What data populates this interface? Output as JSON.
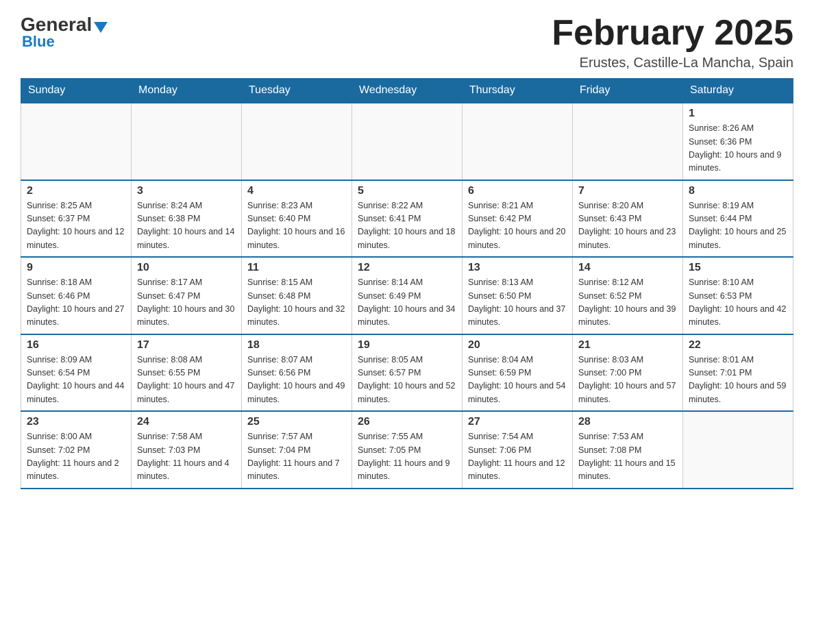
{
  "logo": {
    "general": "General",
    "blue": "Blue"
  },
  "header": {
    "title": "February 2025",
    "location": "Erustes, Castille-La Mancha, Spain"
  },
  "weekdays": [
    "Sunday",
    "Monday",
    "Tuesday",
    "Wednesday",
    "Thursday",
    "Friday",
    "Saturday"
  ],
  "weeks": [
    [
      {
        "day": "",
        "info": ""
      },
      {
        "day": "",
        "info": ""
      },
      {
        "day": "",
        "info": ""
      },
      {
        "day": "",
        "info": ""
      },
      {
        "day": "",
        "info": ""
      },
      {
        "day": "",
        "info": ""
      },
      {
        "day": "1",
        "info": "Sunrise: 8:26 AM\nSunset: 6:36 PM\nDaylight: 10 hours and 9 minutes."
      }
    ],
    [
      {
        "day": "2",
        "info": "Sunrise: 8:25 AM\nSunset: 6:37 PM\nDaylight: 10 hours and 12 minutes."
      },
      {
        "day": "3",
        "info": "Sunrise: 8:24 AM\nSunset: 6:38 PM\nDaylight: 10 hours and 14 minutes."
      },
      {
        "day": "4",
        "info": "Sunrise: 8:23 AM\nSunset: 6:40 PM\nDaylight: 10 hours and 16 minutes."
      },
      {
        "day": "5",
        "info": "Sunrise: 8:22 AM\nSunset: 6:41 PM\nDaylight: 10 hours and 18 minutes."
      },
      {
        "day": "6",
        "info": "Sunrise: 8:21 AM\nSunset: 6:42 PM\nDaylight: 10 hours and 20 minutes."
      },
      {
        "day": "7",
        "info": "Sunrise: 8:20 AM\nSunset: 6:43 PM\nDaylight: 10 hours and 23 minutes."
      },
      {
        "day": "8",
        "info": "Sunrise: 8:19 AM\nSunset: 6:44 PM\nDaylight: 10 hours and 25 minutes."
      }
    ],
    [
      {
        "day": "9",
        "info": "Sunrise: 8:18 AM\nSunset: 6:46 PM\nDaylight: 10 hours and 27 minutes."
      },
      {
        "day": "10",
        "info": "Sunrise: 8:17 AM\nSunset: 6:47 PM\nDaylight: 10 hours and 30 minutes."
      },
      {
        "day": "11",
        "info": "Sunrise: 8:15 AM\nSunset: 6:48 PM\nDaylight: 10 hours and 32 minutes."
      },
      {
        "day": "12",
        "info": "Sunrise: 8:14 AM\nSunset: 6:49 PM\nDaylight: 10 hours and 34 minutes."
      },
      {
        "day": "13",
        "info": "Sunrise: 8:13 AM\nSunset: 6:50 PM\nDaylight: 10 hours and 37 minutes."
      },
      {
        "day": "14",
        "info": "Sunrise: 8:12 AM\nSunset: 6:52 PM\nDaylight: 10 hours and 39 minutes."
      },
      {
        "day": "15",
        "info": "Sunrise: 8:10 AM\nSunset: 6:53 PM\nDaylight: 10 hours and 42 minutes."
      }
    ],
    [
      {
        "day": "16",
        "info": "Sunrise: 8:09 AM\nSunset: 6:54 PM\nDaylight: 10 hours and 44 minutes."
      },
      {
        "day": "17",
        "info": "Sunrise: 8:08 AM\nSunset: 6:55 PM\nDaylight: 10 hours and 47 minutes."
      },
      {
        "day": "18",
        "info": "Sunrise: 8:07 AM\nSunset: 6:56 PM\nDaylight: 10 hours and 49 minutes."
      },
      {
        "day": "19",
        "info": "Sunrise: 8:05 AM\nSunset: 6:57 PM\nDaylight: 10 hours and 52 minutes."
      },
      {
        "day": "20",
        "info": "Sunrise: 8:04 AM\nSunset: 6:59 PM\nDaylight: 10 hours and 54 minutes."
      },
      {
        "day": "21",
        "info": "Sunrise: 8:03 AM\nSunset: 7:00 PM\nDaylight: 10 hours and 57 minutes."
      },
      {
        "day": "22",
        "info": "Sunrise: 8:01 AM\nSunset: 7:01 PM\nDaylight: 10 hours and 59 minutes."
      }
    ],
    [
      {
        "day": "23",
        "info": "Sunrise: 8:00 AM\nSunset: 7:02 PM\nDaylight: 11 hours and 2 minutes."
      },
      {
        "day": "24",
        "info": "Sunrise: 7:58 AM\nSunset: 7:03 PM\nDaylight: 11 hours and 4 minutes."
      },
      {
        "day": "25",
        "info": "Sunrise: 7:57 AM\nSunset: 7:04 PM\nDaylight: 11 hours and 7 minutes."
      },
      {
        "day": "26",
        "info": "Sunrise: 7:55 AM\nSunset: 7:05 PM\nDaylight: 11 hours and 9 minutes."
      },
      {
        "day": "27",
        "info": "Sunrise: 7:54 AM\nSunset: 7:06 PM\nDaylight: 11 hours and 12 minutes."
      },
      {
        "day": "28",
        "info": "Sunrise: 7:53 AM\nSunset: 7:08 PM\nDaylight: 11 hours and 15 minutes."
      },
      {
        "day": "",
        "info": ""
      }
    ]
  ]
}
